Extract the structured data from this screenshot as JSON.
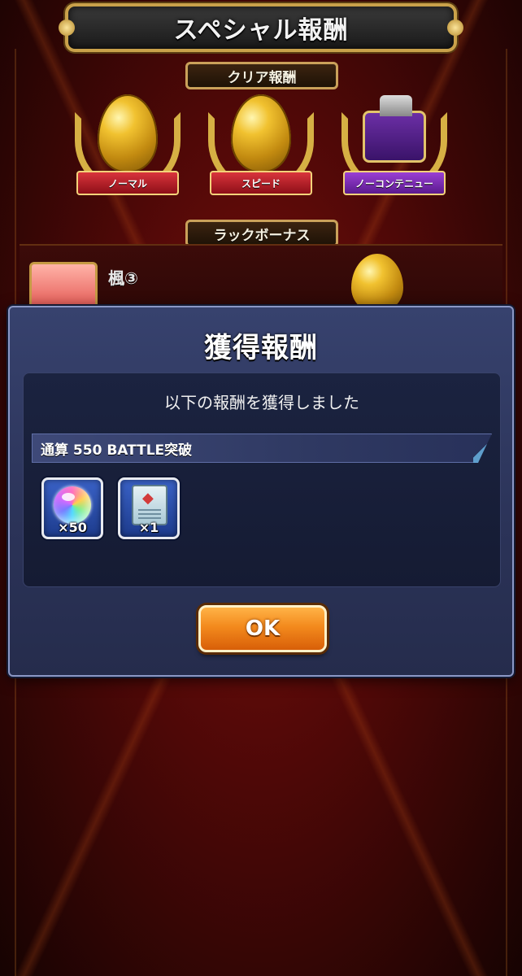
{
  "background": {
    "title": "スペシャル報酬",
    "clear_reward_label": "クリア報酬",
    "rewards": [
      {
        "label": "ノーマル",
        "icon": "golden-egg-icon"
      },
      {
        "label": "スピード",
        "icon": "golden-egg-icon"
      },
      {
        "label": "ノーコンテニュー",
        "icon": "treasure-chest-icon"
      }
    ],
    "luck_bonus_label": "ラックボーナス",
    "luck_character_name": "楓③"
  },
  "modal": {
    "title": "獲得報酬",
    "message": "以下の報酬を獲得しました",
    "category": "通算 550 BATTLE突破",
    "items": [
      {
        "icon": "rainbow-orb-icon",
        "quantity": "×50"
      },
      {
        "icon": "scroll-ticket-icon",
        "quantity": "×1"
      }
    ],
    "ok_label": "OK"
  },
  "colors": {
    "modal_bg": "#2b3358",
    "ok_button": "#f38a1d",
    "background_red": "#4e0807"
  }
}
